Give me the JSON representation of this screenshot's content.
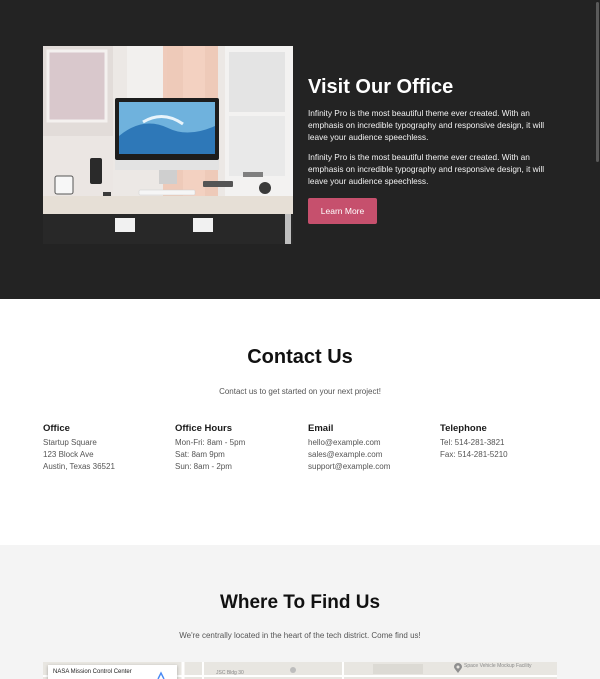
{
  "office": {
    "title": "Visit Our Office",
    "paragraphs": [
      "Infinity Pro is the most beautiful theme ever created. With an emphasis on incredible typography and responsive design, it will leave your audience speechless.",
      "Infinity Pro is the most beautiful theme ever created. With an emphasis on incredible typography and responsive design, it will leave your audience speechless."
    ],
    "button_label": "Learn More",
    "accent_color": "#c6506d"
  },
  "contact": {
    "title": "Contact Us",
    "subtitle": "Contact us to get started on your next project!",
    "columns": [
      {
        "heading": "Office",
        "lines": [
          "Startup Square",
          "123 Block Ave",
          "Austin, Texas 36521"
        ]
      },
      {
        "heading": "Office Hours",
        "lines": [
          "Mon-Fri: 8am - 5pm",
          "Sat: 8am 9pm",
          "Sun: 8am - 2pm"
        ]
      },
      {
        "heading": "Email",
        "lines": [
          "hello@example.com",
          "sales@example.com",
          "support@example.com"
        ]
      },
      {
        "heading": "Telephone",
        "lines": [
          "Tel: 514-281-3821",
          "Fax: 514-281-5210"
        ]
      }
    ]
  },
  "find": {
    "title": "Where To Find Us",
    "subtitle": "We're centrally located in the heart of the tech district. Come find us!",
    "map": {
      "card_title": "NASA Mission Control Center",
      "road_label": "JSC Bldg 30",
      "place_label": "Space Vehicle Mockup Facility"
    }
  }
}
